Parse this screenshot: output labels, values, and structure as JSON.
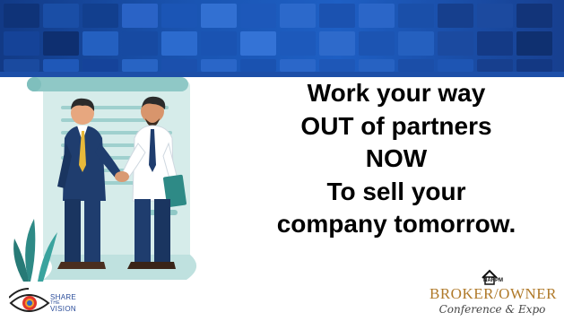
{
  "colors": {
    "banner_primary": "#1a55b3",
    "banner_dark": "#123a86",
    "headline_text": "#000000",
    "document_teal": "#bfe1df",
    "document_teal_dark": "#8fc8c6",
    "suit_navy": "#1f3d6e",
    "tie_gold": "#e8b93a",
    "broker_owner_gold": "#b07a2a"
  },
  "headline": {
    "lines": [
      "Work your way",
      "OUT of partners",
      "NOW",
      "To sell your",
      "company tomorrow."
    ]
  },
  "illustration": {
    "icon": "handshake-business-illustration"
  },
  "footer": {
    "share_logo": {
      "line1": "SHARE",
      "line2": "THE",
      "line3": "VISION",
      "icon": "eye-icon"
    },
    "broker_owner_logo": {
      "narpm": "NARPM",
      "title": "BROKER/OWNER",
      "subtitle": "Conference & Expo",
      "icon": "house-icon"
    }
  }
}
